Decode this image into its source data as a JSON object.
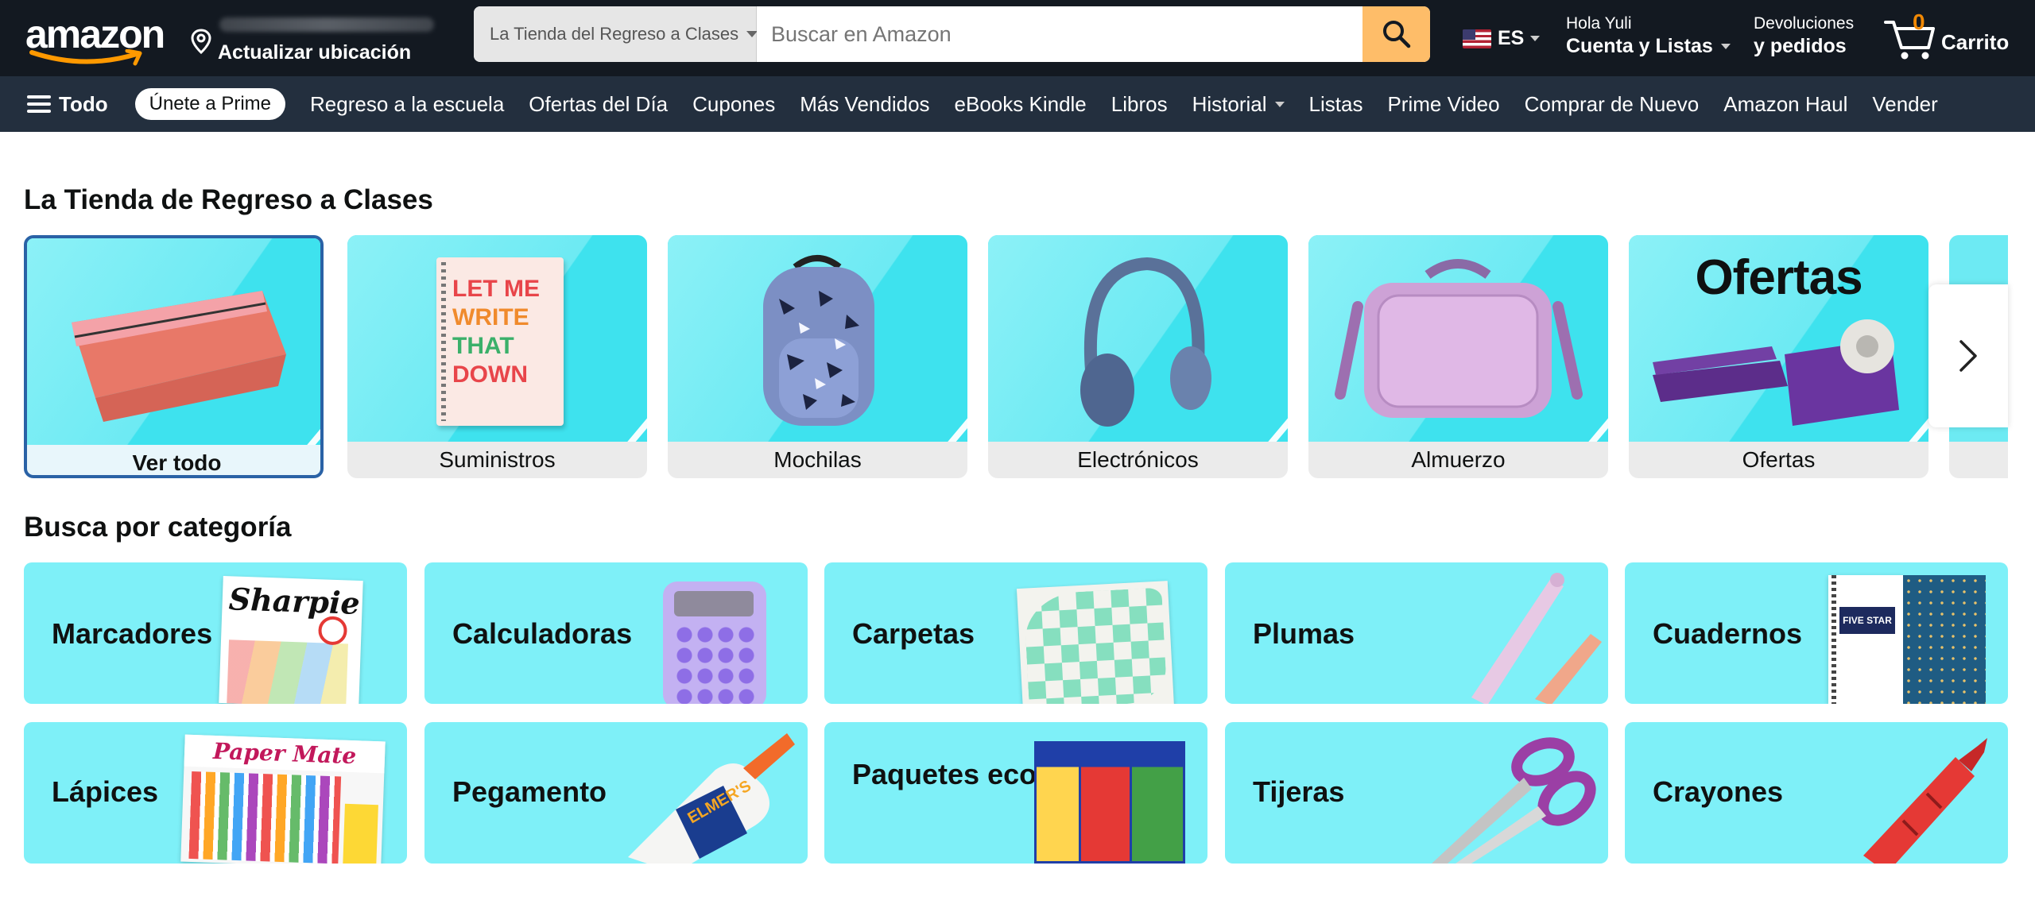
{
  "header": {
    "logo_text": "amazon",
    "location_label": "Actualizar ubicación",
    "search": {
      "department": "La Tienda del Regreso a Clases",
      "placeholder": "Buscar en Amazon"
    },
    "language": "ES",
    "account_greeting": "Hola Yuli",
    "account_lists": "Cuenta y Listas",
    "returns_line1": "Devoluciones",
    "returns_line2": "y pedidos",
    "cart_count": "0",
    "cart_label": "Carrito"
  },
  "subnav": {
    "all_label": "Todo",
    "prime_label": "Únete a Prime",
    "items": [
      "Regreso a la escuela",
      "Ofertas del Día",
      "Cupones",
      "Más Vendidos",
      "eBooks Kindle",
      "Libros",
      "Historial",
      "Listas",
      "Prime Video",
      "Comprar de Nuevo",
      "Amazon Haul",
      "Vender"
    ]
  },
  "store": {
    "title": "La Tienda de Regreso a Clases",
    "tiles": [
      {
        "label": "Ver todo",
        "selected": true
      },
      {
        "label": "Suministros"
      },
      {
        "label": "Mochilas"
      },
      {
        "label": "Electrónicos"
      },
      {
        "label": "Almuerzo"
      },
      {
        "label": "Ofertas",
        "banner": "Ofertas"
      }
    ],
    "notebook_text": [
      "LET ME",
      "WRITE",
      "THAT",
      "DOWN"
    ]
  },
  "categories": {
    "title": "Busca por categoría",
    "items": [
      {
        "label": "Marcadores",
        "brand": "Sharpie"
      },
      {
        "label": "Calculadoras"
      },
      {
        "label": "Carpetas"
      },
      {
        "label": "Plumas"
      },
      {
        "label": "Cuadernos",
        "brand": "FIVE STAR"
      },
      {
        "label": "Lápices",
        "brand": "Paper Mate"
      },
      {
        "label": "Pegamento",
        "brand": "ELMER'S"
      },
      {
        "label": "Paquetes económicos"
      },
      {
        "label": "Tijeras"
      },
      {
        "label": "Crayones"
      }
    ]
  },
  "colors": {
    "header_bg": "#131921",
    "subnav_bg": "#232f3e",
    "search_button": "#febd69",
    "cart_count": "#f08804",
    "tile_bg": "#3ee2ee",
    "category_bg": "#7ef0f8",
    "selected_border": "#2a62a6"
  }
}
